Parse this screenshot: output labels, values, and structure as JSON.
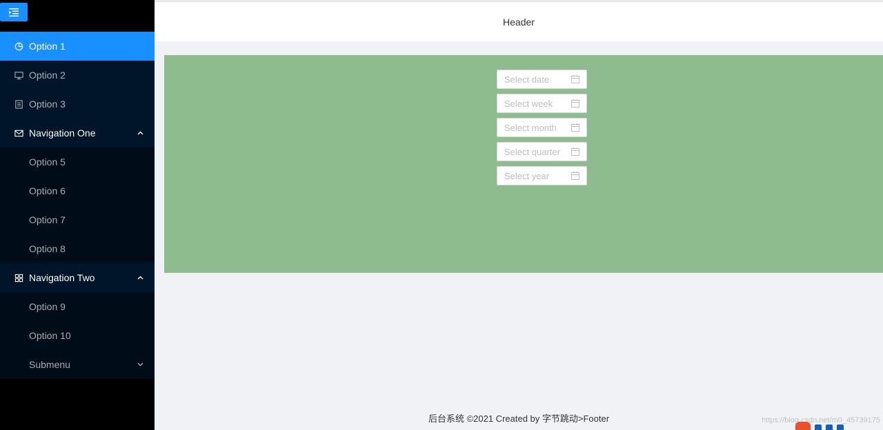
{
  "sidebar": {
    "collapse_icon": "menu-fold-icon",
    "items": [
      {
        "label": "Option 1",
        "icon": "pie-chart-icon",
        "selected": true
      },
      {
        "label": "Option 2",
        "icon": "desktop-icon"
      },
      {
        "label": "Option 3",
        "icon": "container-icon"
      }
    ],
    "submenus": [
      {
        "label": "Navigation One",
        "icon": "mail-icon",
        "expanded": true,
        "items": [
          "Option 5",
          "Option 6",
          "Option 7",
          "Option 8"
        ]
      },
      {
        "label": "Navigation Two",
        "icon": "appstore-icon",
        "expanded": true,
        "items": [
          "Option 9",
          "Option 10"
        ],
        "nested": {
          "label": "Submenu",
          "expanded": false
        }
      }
    ]
  },
  "header": {
    "title": "Header"
  },
  "content": {
    "background": "#8fbc8f",
    "pickers": [
      {
        "placeholder": "Select date"
      },
      {
        "placeholder": "Select week"
      },
      {
        "placeholder": "Select month"
      },
      {
        "placeholder": "Select quarter"
      },
      {
        "placeholder": "Select year"
      }
    ]
  },
  "footer": {
    "text": "后台系统 ©2021 Created by 字节跳动>Footer"
  },
  "watermark": "https://blog.csdn.net/m0_45739175",
  "colors": {
    "primary": "#1890ff",
    "sider": "#001529",
    "submenu_bg": "#000c17"
  }
}
